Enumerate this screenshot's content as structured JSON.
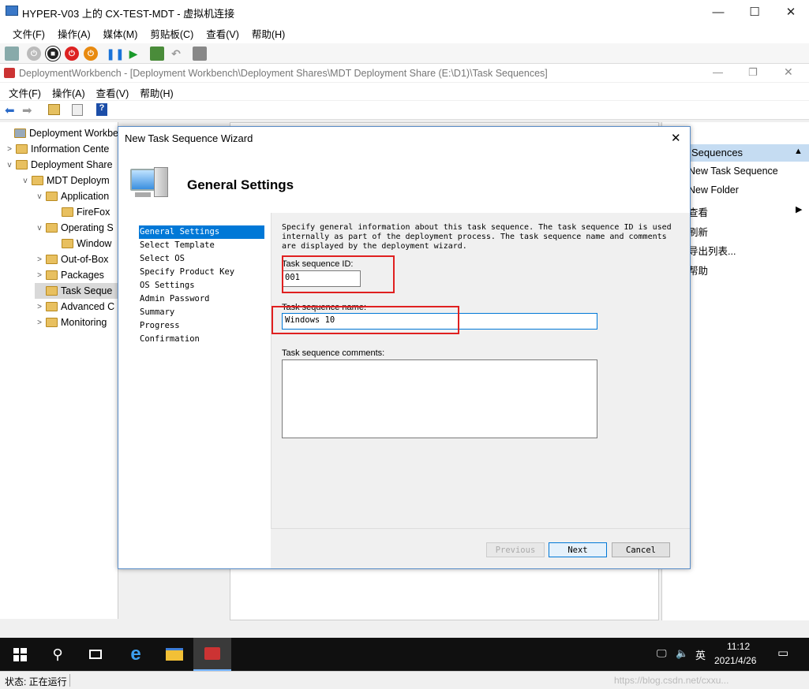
{
  "vm": {
    "title": "HYPER-V03 上的 CX-TEST-MDT - 虚拟机连接",
    "menu": [
      "文件(F)",
      "操作(A)",
      "媒体(M)",
      "剪贴板(C)",
      "查看(V)",
      "帮助(H)"
    ],
    "status": "状态: 正在运行"
  },
  "mmc": {
    "title": "DeploymentWorkbench - [Deployment Workbench\\Deployment Shares\\MDT Deployment Share (E:\\D1)\\Task Sequences]",
    "menu": [
      "文件(F)",
      "操作(A)",
      "查看(V)",
      "帮助(H)"
    ],
    "tree": [
      {
        "label": "Deployment Workbe",
        "arrow": ""
      },
      {
        "label": "Information Cente",
        "arrow": ">"
      },
      {
        "label": "Deployment Share",
        "arrow": "v"
      },
      {
        "label": "MDT Deploym",
        "arrow": "v"
      },
      {
        "label": "Application",
        "arrow": "v"
      },
      {
        "label": "FireFox",
        "arrow": ""
      },
      {
        "label": "Operating S",
        "arrow": "v"
      },
      {
        "label": "Window",
        "arrow": ""
      },
      {
        "label": "Out-of-Box",
        "arrow": ">"
      },
      {
        "label": "Packages",
        "arrow": ">"
      },
      {
        "label": "Task Seque",
        "arrow": ""
      },
      {
        "label": "Advanced C",
        "arrow": ">"
      },
      {
        "label": "Monitoring",
        "arrow": ">"
      }
    ],
    "actions": {
      "header": "Sequences",
      "items": [
        "New Task Sequence",
        "New Folder",
        "查看",
        "刷新",
        "导出列表...",
        "帮助"
      ]
    }
  },
  "wizard": {
    "title": "New Task Sequence Wizard",
    "heading": "General Settings",
    "steps": [
      "General Settings",
      "Select Template",
      "Select OS",
      "Specify Product Key",
      "OS Settings",
      "Admin Password",
      "Summary",
      "Progress",
      "Confirmation"
    ],
    "description": "Specify general information about this task sequence.  The task sequence ID is used internally as part of the deployment process.  The task sequence name and comments are displayed by the deployment wizard.",
    "id_label": "Task sequence ID:",
    "id_value": "001",
    "name_label": "Task sequence name:",
    "name_value": "Windows 10",
    "comments_label": "Task sequence comments:",
    "comments_value": "",
    "btn_previous": "Previous",
    "btn_next": "Next",
    "btn_cancel": "Cancel"
  },
  "taskbar": {
    "time": "11:12",
    "date": "2021/4/26",
    "ime": "英",
    "watermark": "https://blog.csdn.net/cxxu..."
  }
}
